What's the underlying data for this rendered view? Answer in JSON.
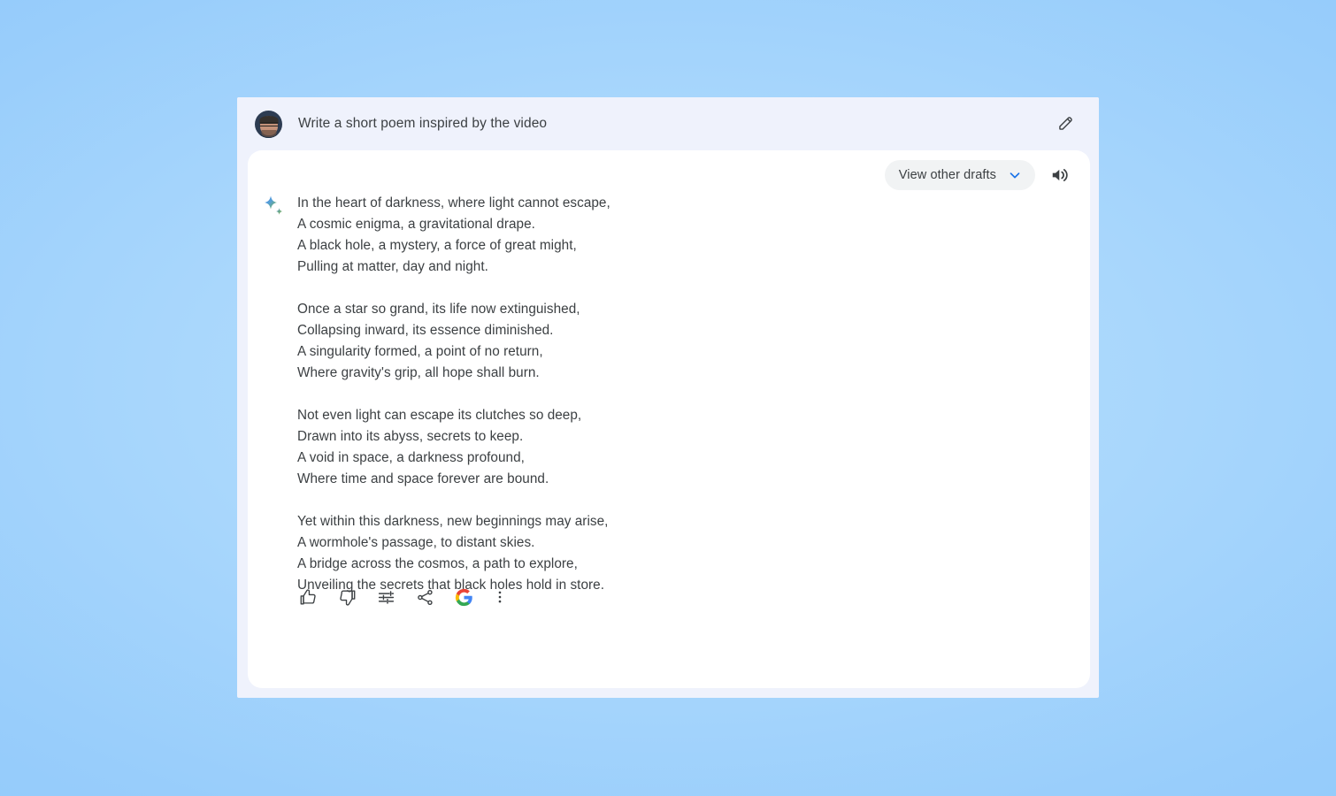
{
  "theme": {
    "page_background_start": "#b3ddfd",
    "page_background_end": "#8ec8fa",
    "container_background": "#eff2fc",
    "card_background": "#ffffff",
    "text_color": "#3c4043",
    "accent_blue": "#1a73e8",
    "chip_background": "#f1f3f4",
    "google_blue": "#4285f4",
    "google_red": "#ea4335",
    "google_yellow": "#fbbc05",
    "google_green": "#34a853",
    "sparkle_blue": "#4285f4",
    "sparkle_green": "#7cb342"
  },
  "prompt": {
    "avatar_name": "user-avatar",
    "text": "Write a short poem inspired by the video",
    "edit_label": "edit-icon"
  },
  "drafts": {
    "view_other_drafts_label": "View other drafts",
    "chevron": "chevron-down-icon",
    "speaker": "speaker-icon"
  },
  "answer": {
    "sparkle": "sparkle-icon",
    "stanzas": [
      [
        "In the heart of darkness, where light cannot escape,",
        "A cosmic enigma, a gravitational drape.",
        "A black hole, a mystery, a force of great might,",
        "Pulling at matter, day and night."
      ],
      [
        "Once a star so grand, its life now extinguished,",
        "Collapsing inward, its essence diminished.",
        "A singularity formed, a point of no return,",
        "Where gravity's grip, all hope shall burn."
      ],
      [
        "Not even light can escape its clutches so deep,",
        "Drawn into its abyss, secrets to keep.",
        "A void in space, a darkness profound,",
        "Where time and space forever are bound."
      ],
      [
        "Yet within this darkness, new beginnings may arise,",
        "A wormhole's passage, to distant skies.",
        "A bridge across the cosmos, a path to explore,",
        "Unveiling the secrets that black holes hold in store."
      ]
    ]
  },
  "actions": [
    {
      "name": "thumb-up-icon",
      "label": "Good response"
    },
    {
      "name": "thumb-down-icon",
      "label": "Bad response"
    },
    {
      "name": "tune-icon",
      "label": "Modify response"
    },
    {
      "name": "share-icon",
      "label": "Share & export"
    },
    {
      "name": "google-search-icon",
      "label": "Google it"
    },
    {
      "name": "more-vert-icon",
      "label": "More"
    }
  ]
}
